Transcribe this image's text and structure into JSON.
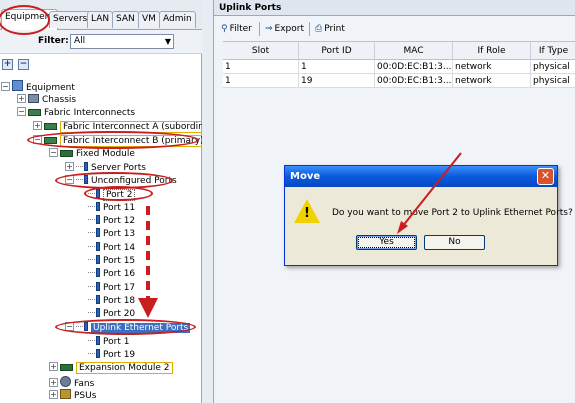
{
  "tabs": [
    "Equipment",
    "Servers",
    "LAN",
    "SAN",
    "VM",
    "Admin"
  ],
  "filter": {
    "label": "Filter:",
    "value": "All"
  },
  "expand_controls": [
    "+",
    "−"
  ],
  "tree": {
    "equipment": "Equipment",
    "chassis": "Chassis",
    "fabric_interconnects": "Fabric Interconnects",
    "fi_a": "Fabric Interconnect A (subordinate",
    "fi_b": "Fabric Interconnect B (primary)",
    "fixed_module": "Fixed Module",
    "server_ports": "Server Ports",
    "unconfigured_ports": "Unconfigured Ports",
    "unconfigured_list": [
      "Port 2",
      "Port 11",
      "Port 12",
      "Port 13",
      "Port 14",
      "Port 15",
      "Port 16",
      "Port 17",
      "Port 18",
      "Port 20"
    ],
    "uplink_ethernet_ports": "Uplink Ethernet Ports",
    "uplink_list": [
      "Port 1",
      "Port 19"
    ],
    "expansion_module": "Expansion Module 2",
    "fans": "Fans",
    "psus": "PSUs"
  },
  "right_panel": {
    "title": "Uplink Ports",
    "toolbar": {
      "filter": "Filter",
      "export": "Export",
      "print": "Print"
    },
    "columns": [
      "Slot",
      "Port ID",
      "MAC",
      "If Role",
      "If Type"
    ],
    "rows": [
      [
        "1",
        "1",
        "00:0D:EC:B1:3...",
        "network",
        "physical"
      ],
      [
        "1",
        "19",
        "00:0D:EC:B1:3...",
        "network",
        "physical"
      ]
    ]
  },
  "dialog": {
    "title": "Move",
    "close": "✕",
    "message": "Do you want to move Port 2 to Uplink Ethernet Ports?",
    "yes": "Yes",
    "no": "No"
  },
  "colors": {
    "annotation": "#c81e1e",
    "selection": "#3c6ec2",
    "dialog_title": "#0a5bdc"
  }
}
